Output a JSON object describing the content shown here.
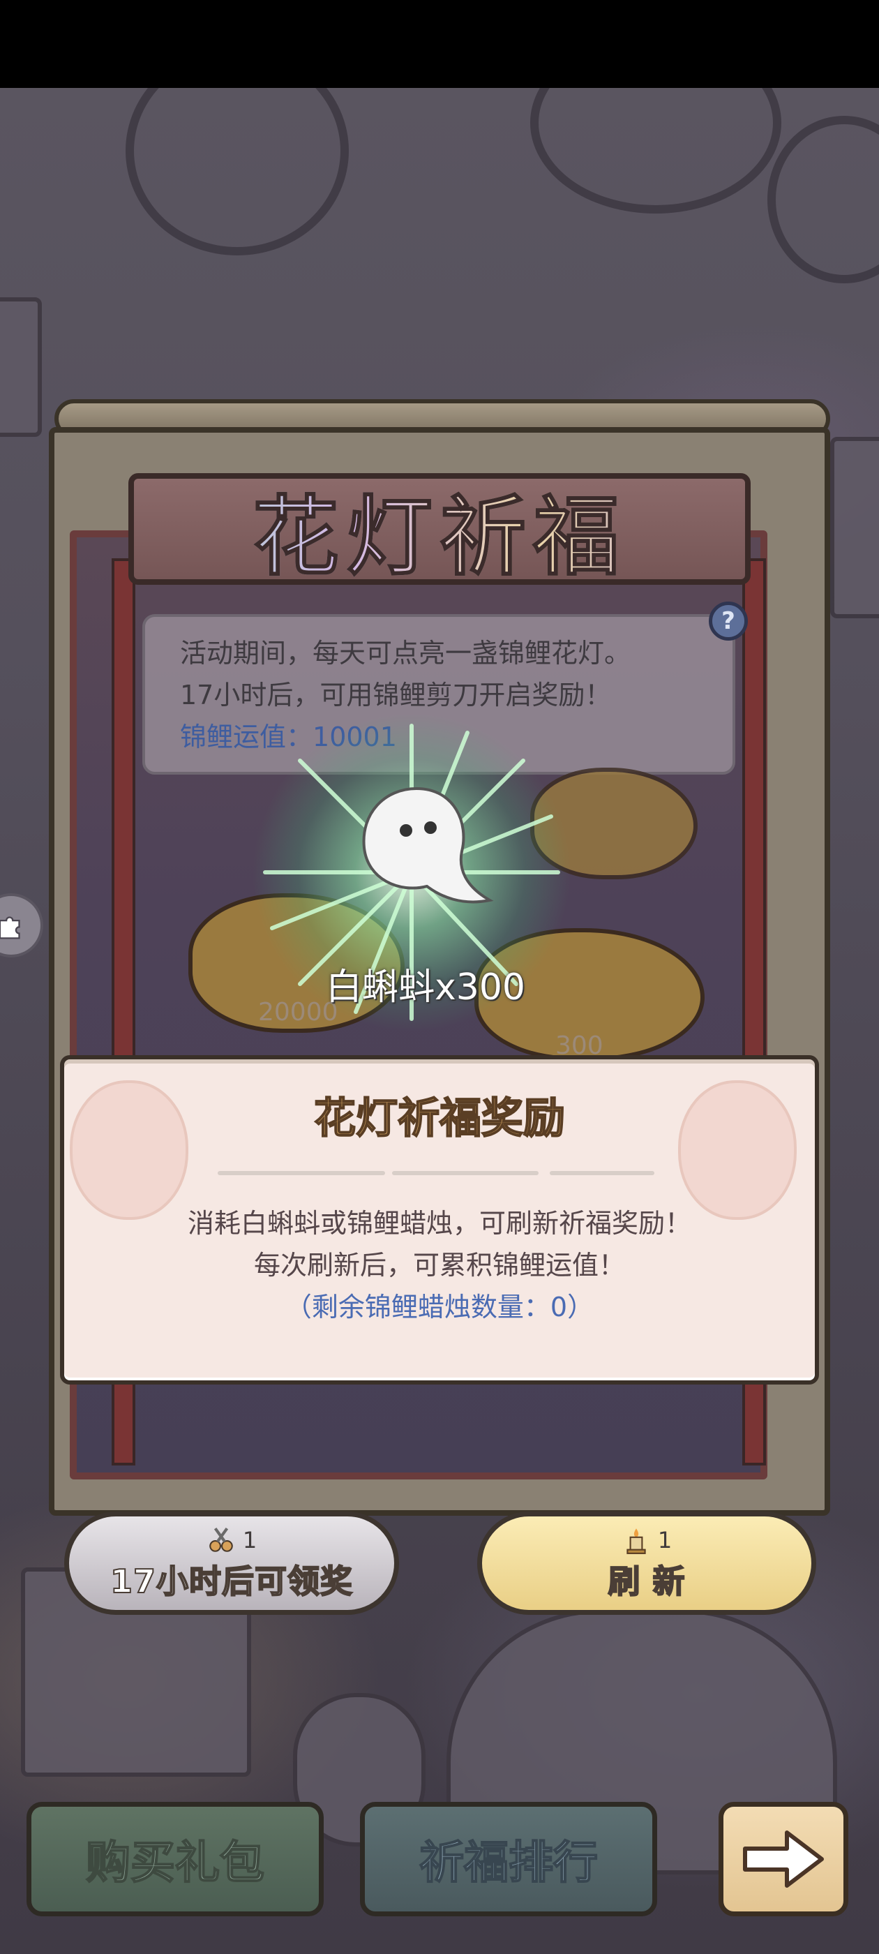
{
  "title": "花灯祈福",
  "info": {
    "line1": "活动期间，每天可点亮一盏锦鲤花灯。",
    "line2": "17小时后，可用锦鲤剪刀开启奖励！",
    "luck_label": "锦鲤运值：",
    "luck_value": "10001"
  },
  "lanterns": {
    "left_value": "20000",
    "right_value": "300"
  },
  "reward": {
    "label": "白蝌蚪x300",
    "icon": "ghost-tadpole-icon"
  },
  "dialog": {
    "title": "花灯祈福奖励",
    "line1": "消耗白蝌蚪或锦鲤蜡烛，可刷新祈福奖励！",
    "line2": "每次刷新后，可累积锦鲤运值！",
    "remaining": "（剩余锦鲤蜡烛数量：0）"
  },
  "buttons": {
    "claim": {
      "cost": "1",
      "cost_icon": "scissors-icon",
      "label": "17小时后可领奖"
    },
    "refresh": {
      "cost": "1",
      "cost_icon": "candle-icon",
      "label": "刷 新"
    }
  },
  "bottom": {
    "gift": "购买礼包",
    "rank": "祈福排行",
    "next_icon": "arrow-right-icon"
  },
  "colors": {
    "luck_text": "#3e5da0",
    "refresh_button": "#f0d898",
    "claim_button": "#d6d2d8"
  }
}
